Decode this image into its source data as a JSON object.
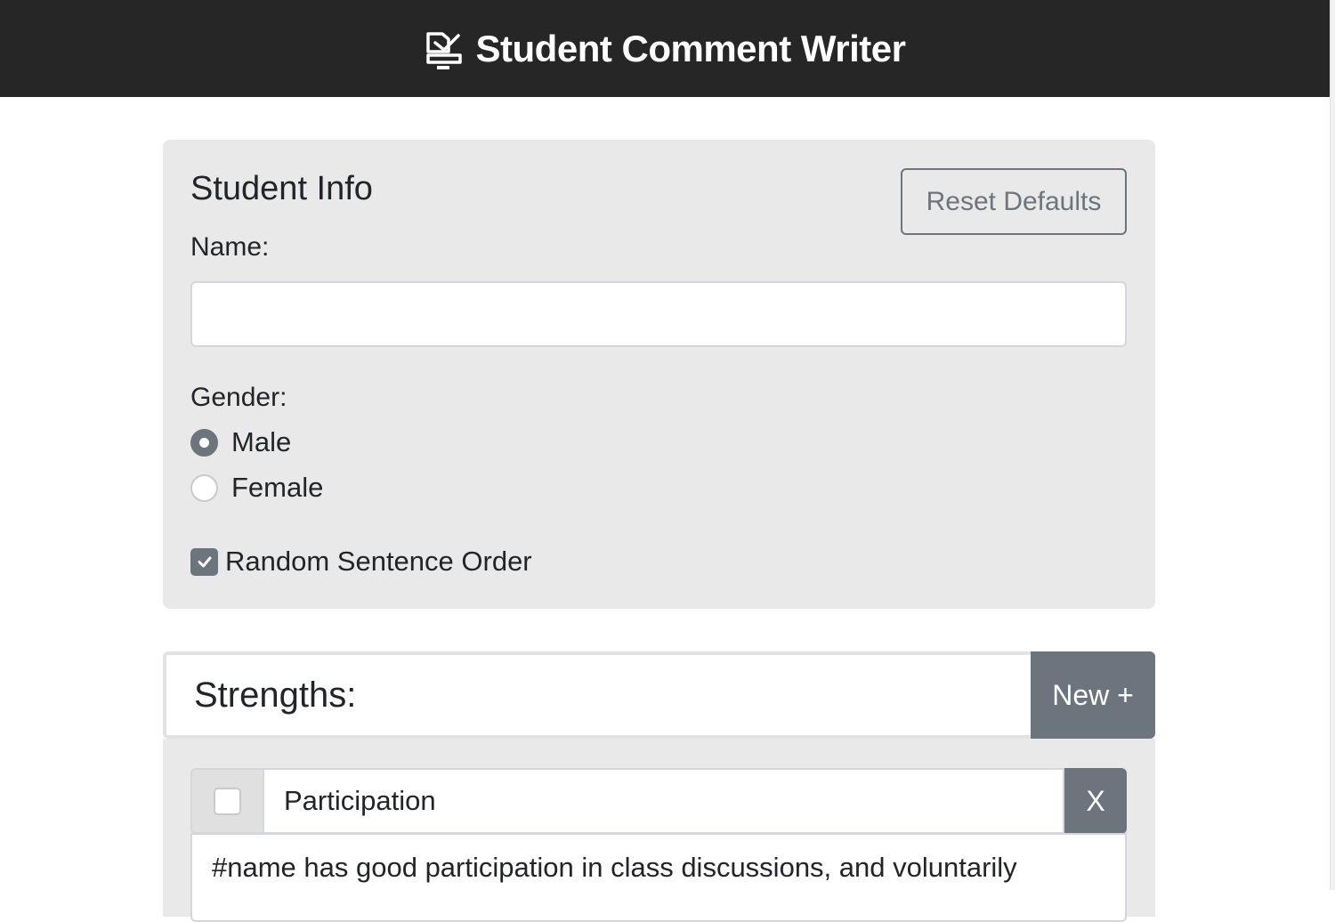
{
  "header": {
    "title": "Student Comment Writer",
    "logo_icon": "notes-comment-icon"
  },
  "student_info": {
    "heading": "Student Info",
    "reset_label": "Reset Defaults",
    "name_label": "Name:",
    "name_value": "",
    "gender_label": "Gender:",
    "gender_options": [
      {
        "label": "Male",
        "selected": true
      },
      {
        "label": "Female",
        "selected": false
      }
    ],
    "random_order_label": "Random Sentence Order",
    "random_order_checked": true
  },
  "strengths": {
    "heading": "Strengths:",
    "new_label": "New +",
    "items": [
      {
        "title": "Participation",
        "checked": false,
        "delete_label": "X",
        "text": "#name has good participation in class discussions, and voluntarily"
      }
    ]
  },
  "colors": {
    "header_bg": "#262626",
    "panel_bg": "#e9e9e9",
    "secondary": "#6c757d"
  }
}
